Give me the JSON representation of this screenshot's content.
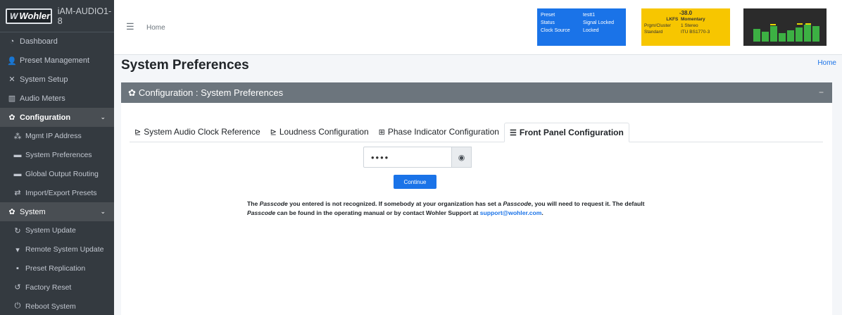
{
  "brand": {
    "logo_text": "Wohler",
    "device_name": "iAM-AUDIO1-8"
  },
  "sidebar": {
    "items": [
      {
        "label": "Dashboard",
        "icon": "dashboard-icon"
      },
      {
        "label": "Preset Management",
        "icon": "users-cog-icon"
      },
      {
        "label": "System Setup",
        "icon": "tools-icon"
      },
      {
        "label": "Audio Meters",
        "icon": "chart-icon"
      },
      {
        "label": "Configuration",
        "icon": "gear-icon"
      },
      {
        "label": "Mgmt IP Address",
        "icon": "network-icon"
      },
      {
        "label": "System Preferences",
        "icon": "keyboard-icon"
      },
      {
        "label": "Global Output Routing",
        "icon": "keyboard-icon"
      },
      {
        "label": "Import/Export Presets",
        "icon": "exchange-icon"
      },
      {
        "label": "System",
        "icon": "cogs-icon"
      },
      {
        "label": "System Update",
        "icon": "sync-icon"
      },
      {
        "label": "Remote System Update",
        "icon": "satellite-icon"
      },
      {
        "label": "Preset Replication",
        "icon": "clone-icon"
      },
      {
        "label": "Factory Reset",
        "icon": "undo-icon"
      },
      {
        "label": "Reboot System",
        "icon": "power-icon"
      }
    ]
  },
  "topbar": {
    "home": "Home",
    "preset_box": {
      "rows": [
        {
          "key": "Preset",
          "value": "testt1"
        },
        {
          "key": "Status",
          "value": "Signal Locked"
        },
        {
          "key": "Clock Source",
          "value": "Locked"
        }
      ],
      "color": "#1a73e8"
    },
    "loudness_box": {
      "value": "-38.0",
      "unit": "LKFS",
      "mode": "Momentary",
      "rows": [
        {
          "key": "Prgm/Cluster",
          "value": "1  Stereo"
        },
        {
          "key": "Standard",
          "value": "ITU BS1770-3"
        }
      ],
      "color": "#f7c600"
    }
  },
  "page": {
    "title": "System Preferences",
    "breadcrumb": "Home"
  },
  "card": {
    "header": "Configuration : System Preferences",
    "collapse": "−"
  },
  "tabs": [
    {
      "label": "System Audio Clock Reference",
      "icon": "chart-icon"
    },
    {
      "label": "Loudness Configuration",
      "icon": "chart-icon"
    },
    {
      "label": "Phase Indicator Configuration",
      "icon": "grid-icon"
    },
    {
      "label": "Front Panel Configuration",
      "icon": "list-icon"
    }
  ],
  "passcode": {
    "value": "••••",
    "eye_icon": "eye-icon"
  },
  "continue_label": "Continue",
  "message": {
    "part1": "The ",
    "em1": "Passcode",
    "part2": " you entered is not recognized. If somebody at your organization has set a ",
    "em2": "Passcode",
    "part3": ", you will need to request it. The default ",
    "em3": "Passcode",
    "part4": " can be found in the operating manual or by contact Wohler Support at ",
    "link": "support@wohler.com",
    "part5": "."
  }
}
